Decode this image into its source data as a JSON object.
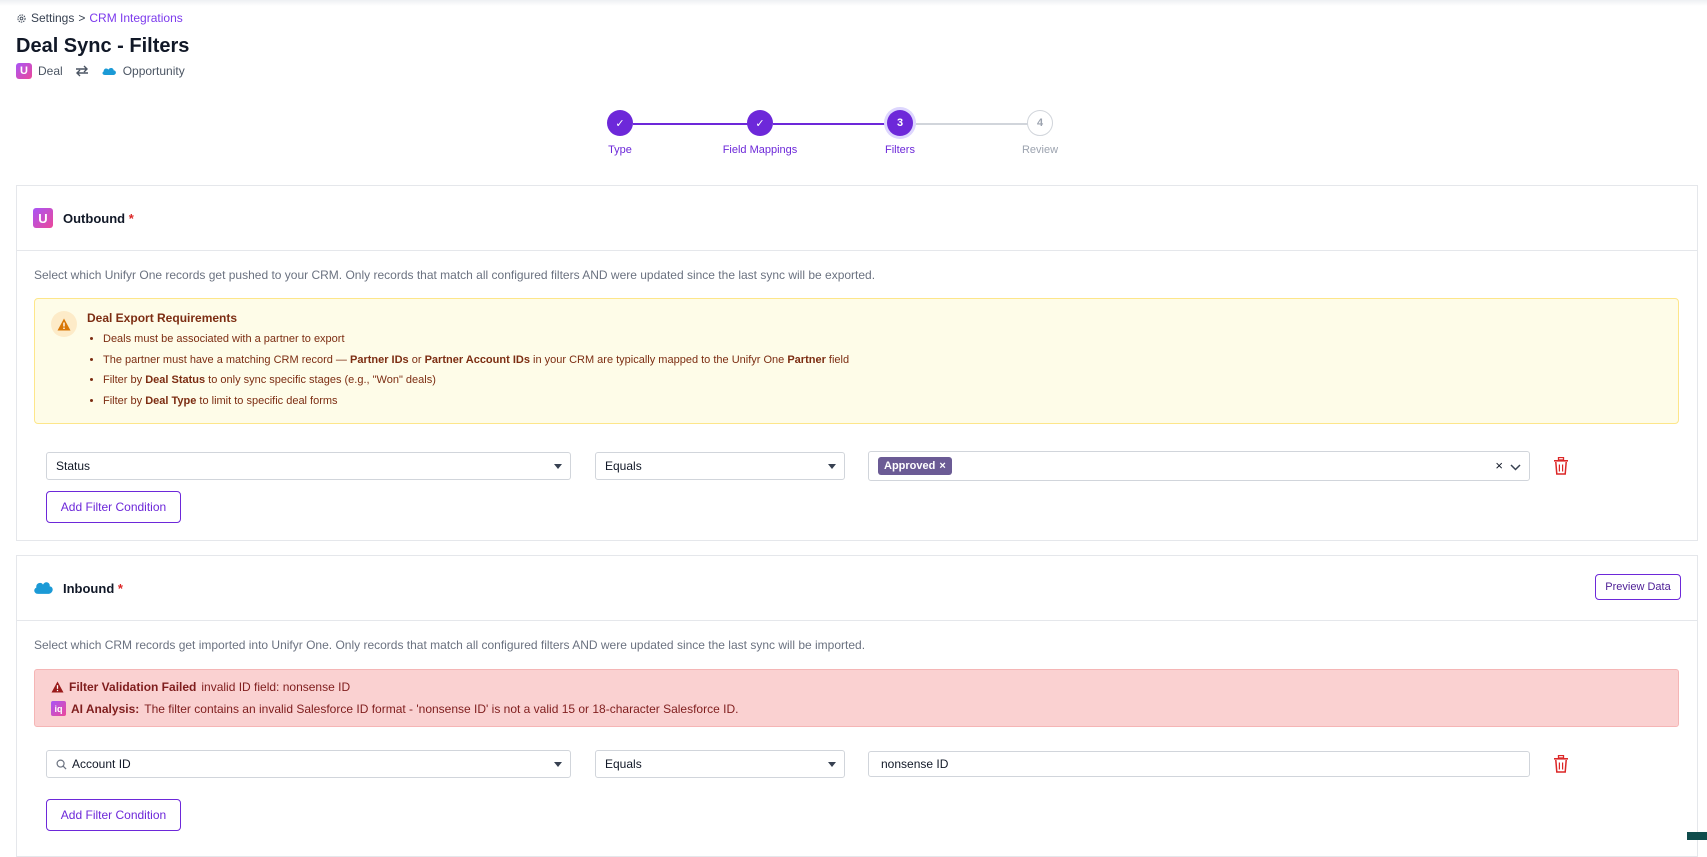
{
  "breadcrumb": {
    "root": "Settings",
    "sep": ">",
    "current": "CRM Integrations"
  },
  "page": {
    "title": "Deal Sync - Filters",
    "source_object": "Deal",
    "target_object": "Opportunity",
    "source_logo": "U"
  },
  "stepper": {
    "steps": [
      {
        "label": "Type",
        "state": "done",
        "marker": "✓"
      },
      {
        "label": "Field Mappings",
        "state": "done",
        "marker": "✓"
      },
      {
        "label": "Filters",
        "state": "current",
        "marker": "3"
      },
      {
        "label": "Review",
        "state": "todo",
        "marker": "4"
      }
    ]
  },
  "outbound": {
    "title": "Outbound",
    "required_mark": "*",
    "description": "Select which Unifyr One records get pushed to your CRM. Only records that match all configured filters AND were updated since the last sync will be exported.",
    "requirements": {
      "title": "Deal Export Requirements",
      "item1": "Deals must be associated with a partner to export",
      "item2_pre": "The partner must have a matching CRM record — ",
      "item2_b1": "Partner IDs",
      "item2_mid": " or ",
      "item2_b2": "Partner Account IDs",
      "item2_mid2": " in your CRM are typically mapped to the Unifyr One ",
      "item2_b3": "Partner",
      "item2_post": " field",
      "item3_pre": "Filter by ",
      "item3_b": "Deal Status",
      "item3_post": " to only sync specific stages (e.g., \"Won\" deals)",
      "item4_pre": "Filter by ",
      "item4_b": "Deal Type",
      "item4_post": " to limit to specific deal forms"
    },
    "filter": {
      "field": "Status",
      "operator": "Equals",
      "chip": "Approved",
      "chip_remove": "×",
      "clear": "×"
    },
    "add_button": "Add Filter Condition"
  },
  "inbound": {
    "title": "Inbound",
    "required_mark": "*",
    "preview_button": "Preview Data",
    "description": "Select which CRM records get imported into Unifyr One. Only records that match all configured filters AND were updated since the last sync will be imported.",
    "error": {
      "title": "Filter Validation Failed",
      "detail": "invalid ID field: nonsense ID",
      "ai_badge": "iq",
      "ai_label": "AI Analysis:",
      "ai_text": "The filter contains an invalid Salesforce ID format - 'nonsense ID' is not a valid 15 or 18-character Salesforce ID."
    },
    "filter": {
      "field": "Account ID",
      "operator": "Equals",
      "value": "nonsense ID"
    },
    "add_button": "Add Filter Condition"
  },
  "colors": {
    "accent": "#6d28d9",
    "error_bg": "#fad1d1",
    "warn_bg": "#fefce8",
    "danger": "#dc2626"
  }
}
